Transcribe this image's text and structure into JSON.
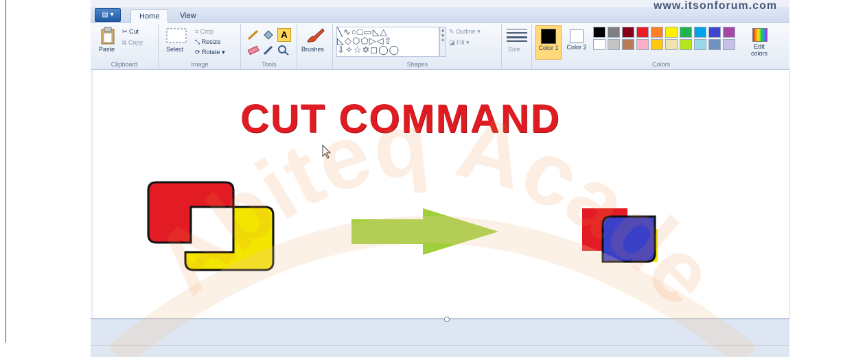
{
  "tabs": {
    "file_label": "▤ ▾",
    "home": "Home",
    "view": "View"
  },
  "title_watermark": "www.itsonforum.com",
  "ribbon": {
    "clipboard": {
      "paste": "Paste",
      "cut": "Cut",
      "copy": "Copy",
      "label": "Clipboard"
    },
    "image": {
      "select": "Select",
      "crop": "Crop",
      "resize": "Resize",
      "rotate": "Rotate",
      "label": "Image"
    },
    "tools": {
      "label": "Tools"
    },
    "brushes": {
      "label": "Brushes"
    },
    "shapes": {
      "outline": "Outline",
      "fill": "Fill",
      "label": "Shapes"
    },
    "size": {
      "label": "Size"
    },
    "colors": {
      "color1": "Color 1",
      "color2": "Color 2",
      "edit": "Edit colors",
      "label": "Colors"
    }
  },
  "palette_row1": [
    "#000000",
    "#7f7f7f",
    "#880015",
    "#ed1c24",
    "#ff7f27",
    "#fff200",
    "#22b14c",
    "#00a2e8",
    "#3f48cc",
    "#a349a4"
  ],
  "palette_row2": [
    "#ffffff",
    "#c3c3c3",
    "#b97a57",
    "#ffaec9",
    "#ffc90e",
    "#efe4b0",
    "#b5e61d",
    "#99d9ea",
    "#7092be",
    "#c8bfe7"
  ],
  "canvas": {
    "headline": "CUT COMMAND"
  },
  "watermark_text": "Abiteq Academy",
  "colors": {
    "accent_red": "#e11b22",
    "yellow": "#f2e600",
    "green_arrow": "#9acd32",
    "blue": "#3a40c8"
  }
}
